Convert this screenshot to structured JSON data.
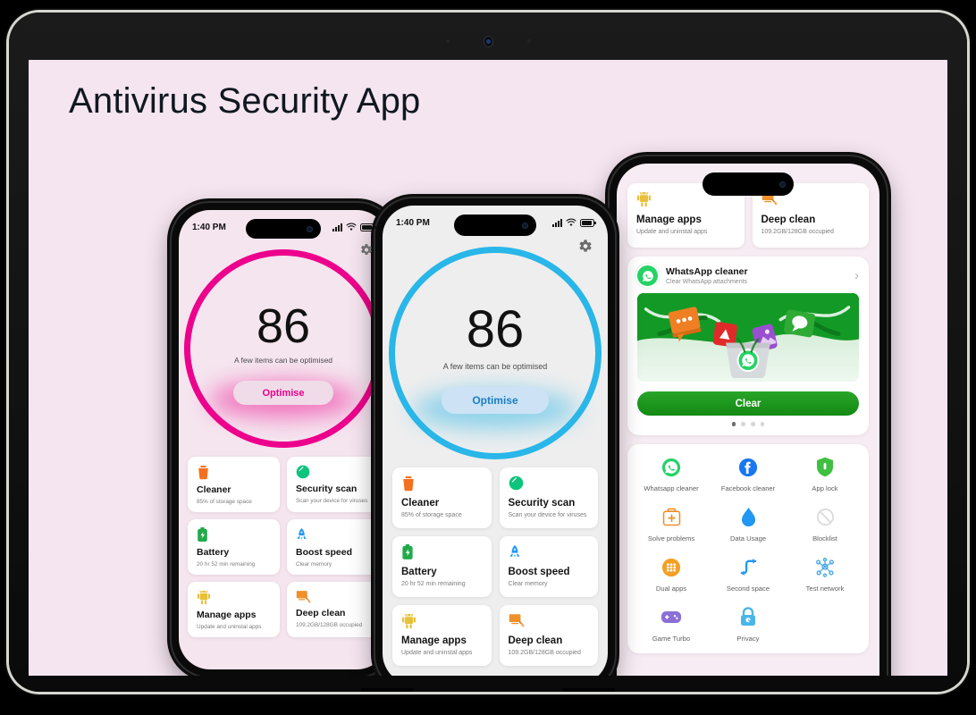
{
  "page": {
    "title": "Antivirus Security App",
    "background_color": "#f5e5f0"
  },
  "phone_left": {
    "theme_color": "#ec008c",
    "screen_background": "#f5e5ef",
    "status": {
      "time": "1:40 PM",
      "signal_icon": "signal-bars-icon",
      "wifi_icon": "wifi-icon",
      "battery_icon": "battery-icon"
    },
    "settings_icon": "gear-icon",
    "score": {
      "value": "86",
      "subtitle": "A few items can be optimised",
      "button": "Optimise"
    },
    "cards": [
      {
        "title": "Cleaner",
        "subtitle": "85% of storage space",
        "icon": "trash-icon",
        "color": "#f4701f"
      },
      {
        "title": "Security scan",
        "subtitle": "Scan your device for viruses",
        "icon": "shield-scan-icon",
        "color": "#0cc47d"
      },
      {
        "title": "Battery",
        "subtitle": "20 hr 52 min remaining",
        "icon": "battery-bolt-icon",
        "color": "#22a94b"
      },
      {
        "title": "Boost speed",
        "subtitle": "Clear memory",
        "icon": "rocket-icon",
        "color": "#2196f3"
      },
      {
        "title": "Manage apps",
        "subtitle": "Update and uninstal apps",
        "icon": "android-robot-icon",
        "color": "#e8c03a"
      },
      {
        "title": "Deep clean",
        "subtitle": "109.2GB/128GB occupied",
        "icon": "deep-clean-icon",
        "color": "#f0902a"
      }
    ]
  },
  "phone_center": {
    "theme_color": "#29b6e8",
    "screen_background": "#eeeeee",
    "status": {
      "time": "1:40 PM",
      "signal_icon": "signal-bars-icon",
      "wifi_icon": "wifi-icon",
      "battery_icon": "battery-icon"
    },
    "settings_icon": "gear-icon",
    "score": {
      "value": "86",
      "subtitle": "A few items can be optimised",
      "button": "Optimise"
    },
    "cards": [
      {
        "title": "Cleaner",
        "subtitle": "85% of storage space",
        "icon": "trash-icon",
        "color": "#f4701f"
      },
      {
        "title": "Security scan",
        "subtitle": "Scan your device for viruses",
        "icon": "shield-scan-icon",
        "color": "#0cc47d"
      },
      {
        "title": "Battery",
        "subtitle": "20 hr 52 min remaining",
        "icon": "battery-bolt-icon",
        "color": "#22a94b"
      },
      {
        "title": "Boost speed",
        "subtitle": "Clear memory",
        "icon": "rocket-icon",
        "color": "#2196f3"
      },
      {
        "title": "Manage apps",
        "subtitle": "Update and uninstal apps",
        "icon": "android-robot-icon",
        "color": "#e8c03a"
      },
      {
        "title": "Deep clean",
        "subtitle": "109.2GB/128GB occupied",
        "icon": "deep-clean-icon",
        "color": "#f0902a"
      }
    ]
  },
  "phone_right": {
    "screen_background": "#f7ecf3",
    "top_cards": [
      {
        "title": "Manage apps",
        "subtitle": "Update and uninstal apps",
        "icon": "android-robot-icon",
        "color": "#e8c03a"
      },
      {
        "title": "Deep clean",
        "subtitle": "109.2GB/128GB occupied",
        "icon": "deep-clean-icon",
        "color": "#f0902a"
      }
    ],
    "whatsapp_cleaner": {
      "title": "WhatsApp cleaner",
      "subtitle": "Clear WhatsApp attachments",
      "icon": "whatsapp-icon",
      "chevron_icon": "chevron-right-icon",
      "illustration": "whatsapp-trash-illustration",
      "button": "Clear",
      "button_color": "#19a019",
      "dots_total": 4,
      "dots_active": 1
    },
    "tools": [
      {
        "label": "Whatsapp cleaner",
        "icon": "whatsapp-icon",
        "color": "#25d366"
      },
      {
        "label": "Facebook cleaner",
        "icon": "facebook-icon",
        "color": "#1877f2"
      },
      {
        "label": "App lock",
        "icon": "shield-lock-icon",
        "color": "#3fc040"
      },
      {
        "label": "Solve problems",
        "icon": "first-aid-icon",
        "color": "#f0902a"
      },
      {
        "label": "Data Usage",
        "icon": "water-drop-icon",
        "color": "#2196f3"
      },
      {
        "label": "Blocklist",
        "icon": "blocklist-icon",
        "color": "#9e9e9e"
      },
      {
        "label": "Dual apps",
        "icon": "dual-apps-icon",
        "color": "#f3a024"
      },
      {
        "label": "Second space",
        "icon": "second-space-arrow-icon",
        "color": "#2196f3"
      },
      {
        "label": "Test network",
        "icon": "network-nodes-icon",
        "color": "#4aa8e8"
      },
      {
        "label": "Game Turbo",
        "icon": "gamepad-icon",
        "color": "#8b6fd6"
      },
      {
        "label": "Privacy",
        "icon": "lock-icon",
        "color": "#4ab5e8"
      }
    ]
  }
}
